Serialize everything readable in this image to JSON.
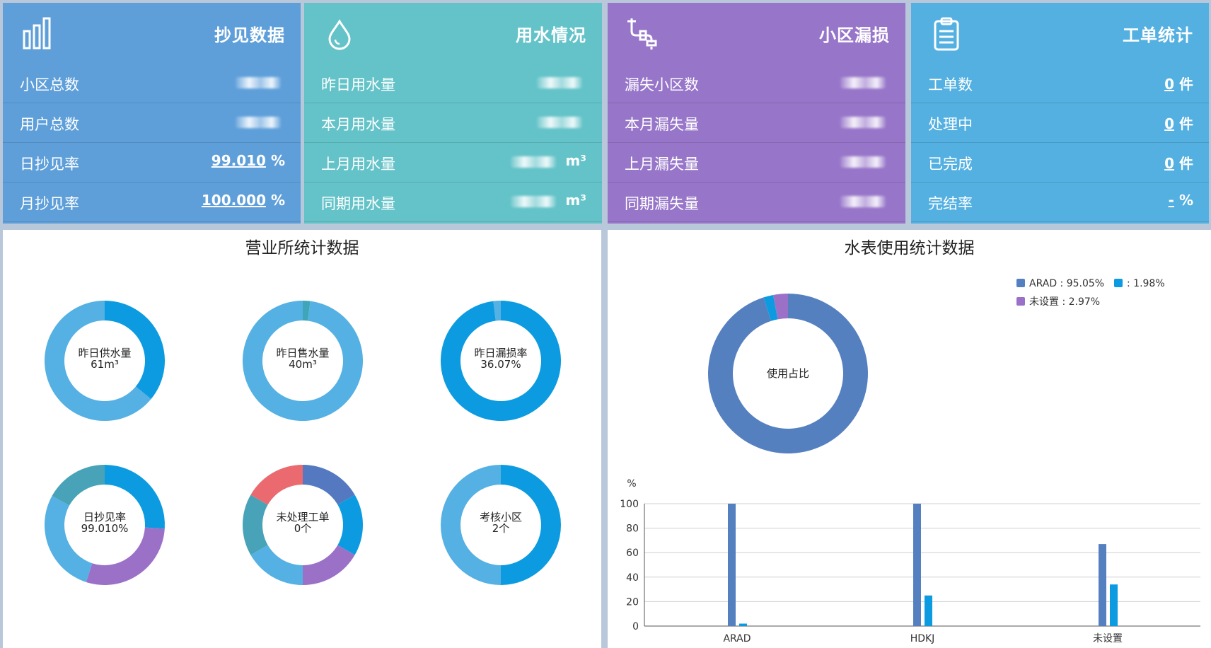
{
  "cards": [
    {
      "title": "抄见数据",
      "color": "#5e9fda",
      "icon": "bar-chart-icon",
      "rows": [
        {
          "label": "小区总数",
          "value": "",
          "unit": ""
        },
        {
          "label": "用户总数",
          "value": "",
          "unit": ""
        },
        {
          "label": "日抄见率",
          "value": "99.010",
          "unit": " %"
        },
        {
          "label": "月抄见率",
          "value": "100.000",
          "unit": " %"
        }
      ]
    },
    {
      "title": "用水情况",
      "color": "#63c3c8",
      "icon": "water-drop-icon",
      "rows": [
        {
          "label": "昨日用水量",
          "value": "",
          "unit": ""
        },
        {
          "label": "本月用水量",
          "value": "",
          "unit": ""
        },
        {
          "label": "上月用水量",
          "value": "",
          "unit": " m³"
        },
        {
          "label": "同期用水量",
          "value": "",
          "unit": " m³"
        }
      ]
    },
    {
      "title": "小区漏损",
      "color": "#9775c9",
      "icon": "leaking-pipe-icon",
      "rows": [
        {
          "label": "漏失小区数",
          "value": "",
          "unit": ""
        },
        {
          "label": "本月漏失量",
          "value": "",
          "unit": ""
        },
        {
          "label": "上月漏失量",
          "value": "",
          "unit": ""
        },
        {
          "label": "同期漏失量",
          "value": "",
          "unit": ""
        }
      ]
    },
    {
      "title": "工单统计",
      "color": "#53b0e1",
      "icon": "clipboard-icon",
      "rows": [
        {
          "label": "工单数",
          "value": "0",
          "unit": " 件"
        },
        {
          "label": "处理中",
          "value": "0",
          "unit": " 件"
        },
        {
          "label": "已完成",
          "value": "0",
          "unit": " 件"
        },
        {
          "label": "完结率",
          "value": "-",
          "unit": " %"
        }
      ]
    }
  ],
  "office_panel": {
    "title": "营业所统计数据",
    "donuts": [
      {
        "label": "昨日供水量",
        "value": "61m³",
        "segments": [
          {
            "value": 36,
            "color": "#0c9be0"
          },
          {
            "value": 64,
            "color": "#55b0e3"
          }
        ]
      },
      {
        "label": "昨日售水量",
        "value": "40m³",
        "segments": [
          {
            "value": 2,
            "color": "#3fa5b9"
          },
          {
            "value": 98,
            "color": "#55b0e3"
          }
        ]
      },
      {
        "label": "昨日漏损率",
        "value": "36.07%",
        "segments": [
          {
            "value": 98,
            "color": "#0c9be0"
          },
          {
            "value": 2,
            "color": "#55b0e3"
          }
        ]
      },
      {
        "label": "日抄见率",
        "value": "99.010%",
        "segments": [
          {
            "value": 26,
            "color": "#0c9be0"
          },
          {
            "value": 29,
            "color": "#9b71c8"
          },
          {
            "value": 28,
            "color": "#55b0e3"
          },
          {
            "value": 17,
            "color": "#48a3b8"
          }
        ]
      },
      {
        "label": "未处理工单",
        "value": "0个",
        "segments": [
          {
            "value": 14,
            "color": "#5479c0"
          },
          {
            "value": 14,
            "color": "#0c9be0"
          },
          {
            "value": 14,
            "color": "#9b71c8"
          },
          {
            "value": 14,
            "color": "#55b0e3"
          },
          {
            "value": 14,
            "color": "#48a3b8"
          },
          {
            "value": 14,
            "color": "#ea6a6f"
          }
        ]
      },
      {
        "label": "考核小区",
        "value": "2个",
        "segments": [
          {
            "value": 50,
            "color": "#0c9be0"
          },
          {
            "value": 50,
            "color": "#55b0e3"
          }
        ]
      }
    ]
  },
  "meter_panel": {
    "title": "水表使用统计数据",
    "pie": {
      "center_label": "使用占比",
      "slices": [
        {
          "name": "ARAD",
          "pct": 95.05,
          "color": "#5580c0"
        },
        {
          "name": "",
          "pct": 1.98,
          "color": "#0c9be0"
        },
        {
          "name": "未设置",
          "pct": 2.97,
          "color": "#9b71c8"
        }
      ]
    },
    "legend": [
      "ARAD : 95.05%",
      " : 1.98%",
      "未设置 : 2.97%"
    ]
  },
  "chart_data": {
    "type": "bar",
    "categories": [
      "ARAD",
      "HDKJ",
      "未设置"
    ],
    "series": [
      {
        "values": [
          100,
          100,
          67
        ],
        "color": "#5580c0"
      },
      {
        "values": [
          2,
          25,
          34
        ],
        "color": "#0c9be0"
      }
    ],
    "ylabel": "%",
    "ylim": [
      0,
      100
    ],
    "yticks": [
      0,
      20,
      40,
      60,
      80,
      100
    ],
    "grid": true
  }
}
